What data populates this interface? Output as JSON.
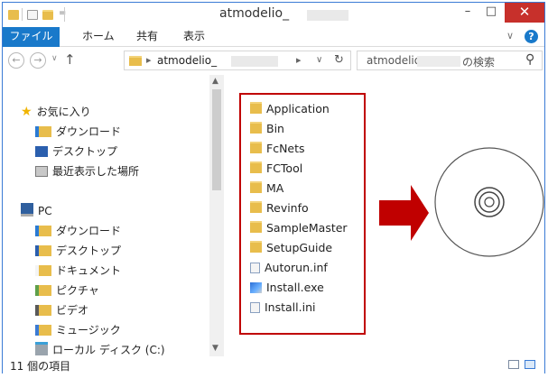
{
  "window": {
    "title": "atmodelio_",
    "quick_access_icons": [
      "folder-icon",
      "properties-icon",
      "new-folder-icon"
    ],
    "buttons": {
      "minimize": "–",
      "maximize": "□",
      "close": "✕"
    }
  },
  "ribbon": {
    "tabs": [
      "ファイル",
      "ホーム",
      "共有",
      "表示"
    ],
    "expand": "∨",
    "help": "?"
  },
  "navbar": {
    "back": "←",
    "forward": "→",
    "recent": "∨",
    "up": "↑",
    "address_sep": "▸",
    "address": "atmodelio_",
    "address_dropdown": "∨",
    "refresh": "↻",
    "search_placeholder_left": "atmodelio_",
    "search_placeholder_right": "の検索",
    "search_icon": "⚲"
  },
  "nav_pane": {
    "favorites_label": "お気に入り",
    "favorites": [
      "ダウンロード",
      "デスクトップ",
      "最近表示した場所"
    ],
    "pc_label": "PC",
    "pc_items": [
      "ダウンロード",
      "デスクトップ",
      "ドキュメント",
      "ピクチャ",
      "ビデオ",
      "ミュージック",
      "ローカル ディスク (C:)"
    ]
  },
  "files": [
    {
      "name": "Application",
      "type": "folder"
    },
    {
      "name": "Bin",
      "type": "folder"
    },
    {
      "name": "FcNets",
      "type": "folder"
    },
    {
      "name": "FCTool",
      "type": "folder"
    },
    {
      "name": "MA",
      "type": "folder"
    },
    {
      "name": "Revinfo",
      "type": "folder"
    },
    {
      "name": "SampleMaster",
      "type": "folder"
    },
    {
      "name": "SetupGuide",
      "type": "folder"
    },
    {
      "name": "Autorun.inf",
      "type": "inf"
    },
    {
      "name": "Install.exe",
      "type": "exe"
    },
    {
      "name": "Install.ini",
      "type": "ini"
    }
  ],
  "status": {
    "item_count": "11 個の項目"
  },
  "colors": {
    "accent": "#1979ca",
    "highlight_border": "#c00000",
    "arrow": "#c00000",
    "close_button": "#c7302b"
  }
}
